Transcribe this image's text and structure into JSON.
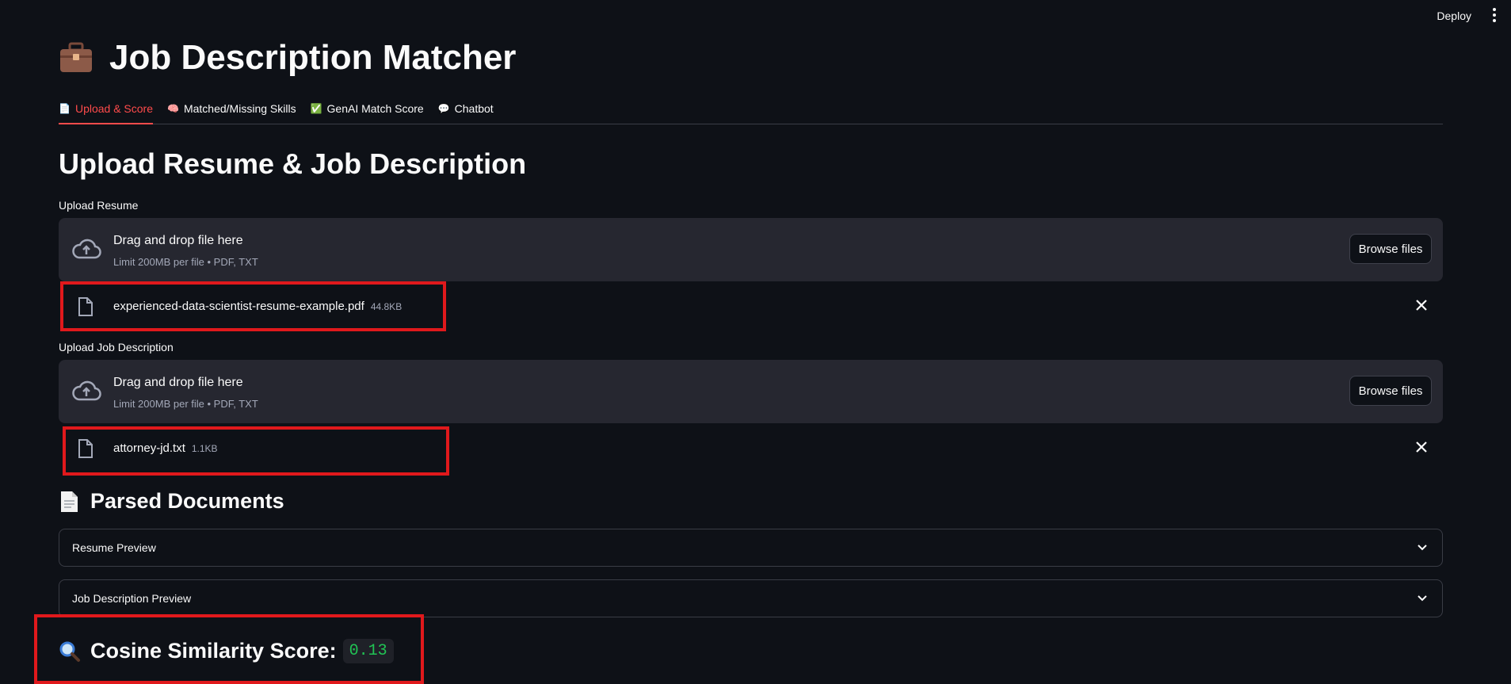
{
  "topbar": {
    "deploy_label": "Deploy"
  },
  "app": {
    "title": "Job Description Matcher",
    "title_icon": "briefcase-icon"
  },
  "tabs": [
    {
      "label": "Upload & Score",
      "icon": "page-icon",
      "active": true
    },
    {
      "label": "Matched/Missing Skills",
      "icon": "brain-icon",
      "active": false
    },
    {
      "label": "GenAI Match Score",
      "icon": "check-box-icon",
      "active": false
    },
    {
      "label": "Chatbot",
      "icon": "speech-bubble-icon",
      "active": false
    }
  ],
  "upload": {
    "heading": "Upload Resume & Job Description",
    "resume": {
      "label": "Upload Resume",
      "drop_title": "Drag and drop file here",
      "drop_sub": "Limit 200MB per file • PDF, TXT",
      "browse_label": "Browse files",
      "file": {
        "name": "experienced-data-scientist-resume-example.pdf",
        "size": "44.8KB"
      }
    },
    "jd": {
      "label": "Upload Job Description",
      "drop_title": "Drag and drop file here",
      "drop_sub": "Limit 200MB per file • PDF, TXT",
      "browse_label": "Browse files",
      "file": {
        "name": "attorney-jd.txt",
        "size": "1.1KB"
      }
    }
  },
  "parsed": {
    "heading": "Parsed Documents",
    "icon": "page-icon",
    "expanders": [
      {
        "label": "Resume Preview"
      },
      {
        "label": "Job Description Preview"
      }
    ]
  },
  "score": {
    "label": "Cosine Similarity Score:",
    "value": "0.13",
    "icon": "magnifier-icon"
  },
  "colors": {
    "background": "#0e1117",
    "accent": "#ff4b4b",
    "highlight_box": "#e0191c",
    "score_green": "#21c354"
  }
}
